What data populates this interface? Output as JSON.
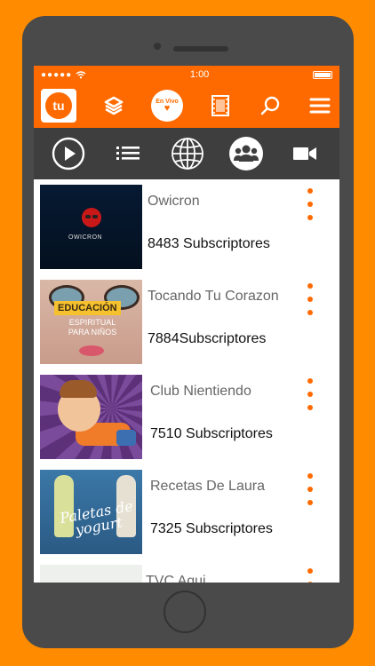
{
  "status_bar": {
    "signal": "●●●●●",
    "time": "1:00"
  },
  "toolbar": {
    "logo_text": "tu",
    "live_label": "En Vivo"
  },
  "tabs": [
    "play",
    "list",
    "globe",
    "community",
    "video"
  ],
  "channels": [
    {
      "name": "Owicron",
      "subscribers": "8483 Subscriptores",
      "thumb_text": "OWICRON"
    },
    {
      "name": "Tocando Tu Corazon",
      "subscribers": "7884Subscriptores",
      "thumb_text": "EDUCACIÓN",
      "thumb_subtext": "ESPIRITUAL PARA NIÑOS"
    },
    {
      "name": "Club Nientiendo",
      "subscribers": "7510 Subscriptores"
    },
    {
      "name": "Recetas De Laura",
      "subscribers": "7325 Subscriptores",
      "thumb_text": "Paletas de yogurt"
    },
    {
      "name": "TVC Aqui",
      "subscribers": ""
    }
  ],
  "colors": {
    "accent": "#FF6A00",
    "frame": "#4a4a4a",
    "background": "#FF8C00"
  }
}
